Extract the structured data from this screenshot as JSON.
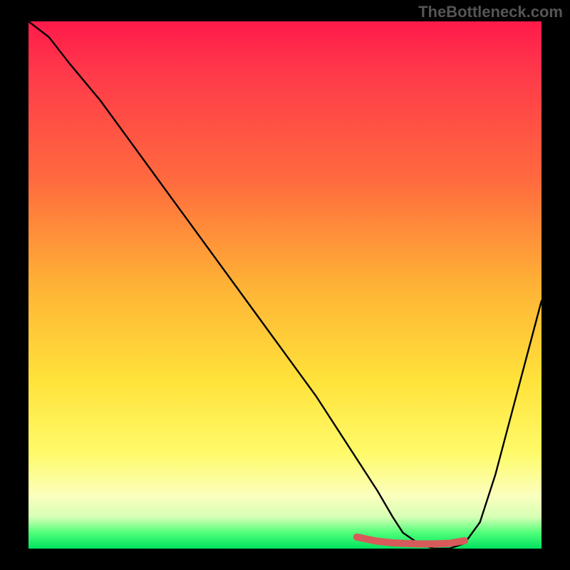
{
  "watermark": "TheBottleneck.com",
  "chart_data": {
    "type": "line",
    "title": "",
    "xlabel": "",
    "ylabel": "",
    "xlim": [
      0,
      100
    ],
    "ylim": [
      0,
      100
    ],
    "grid": false,
    "legend": false,
    "series": [
      {
        "name": "curve",
        "color": "#000000",
        "x": [
          0,
          4,
          8,
          14,
          20,
          26,
          32,
          38,
          44,
          50,
          56,
          60,
          64,
          68,
          71,
          73,
          76,
          79,
          82,
          85,
          88,
          91,
          94,
          97,
          100
        ],
        "values": [
          100,
          97,
          92,
          85,
          77,
          69,
          61,
          53,
          45,
          37,
          29,
          23,
          17,
          11,
          6,
          3,
          1,
          0,
          0,
          1,
          5,
          14,
          25,
          36,
          47
        ]
      },
      {
        "name": "highlight-trough",
        "color": "#d85a5a",
        "x": [
          64,
          68,
          71,
          73,
          76,
          79,
          82,
          85
        ],
        "values": [
          2.2,
          1.4,
          1.1,
          1.0,
          0.9,
          0.9,
          1.0,
          1.5
        ]
      }
    ],
    "background_gradient": {
      "direction": "vertical",
      "stops": [
        {
          "pos": 0,
          "color": "#ff1a4b"
        },
        {
          "pos": 10,
          "color": "#ff3a4a"
        },
        {
          "pos": 30,
          "color": "#ff6a3e"
        },
        {
          "pos": 50,
          "color": "#ffb236"
        },
        {
          "pos": 68,
          "color": "#ffe23a"
        },
        {
          "pos": 82,
          "color": "#fffb6a"
        },
        {
          "pos": 90,
          "color": "#fbffbe"
        },
        {
          "pos": 94,
          "color": "#d6ffb4"
        },
        {
          "pos": 97,
          "color": "#4fff7a"
        },
        {
          "pos": 100,
          "color": "#00e25f"
        }
      ]
    }
  }
}
